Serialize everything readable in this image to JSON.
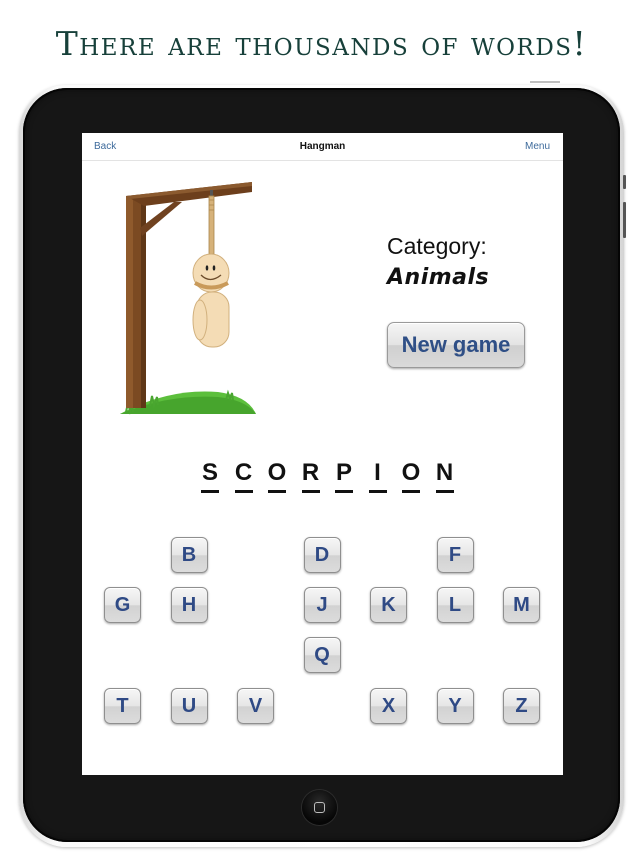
{
  "headline": "There are thousands of words!",
  "nav": {
    "back_label": "Back",
    "title": "Hangman",
    "menu_label": "Menu"
  },
  "category": {
    "label": "Category:",
    "value": "Animals"
  },
  "new_game_label": "New game",
  "word": {
    "letters": [
      "S",
      "C",
      "O",
      "R",
      "P",
      "I",
      "O",
      "N"
    ]
  },
  "keyboard": {
    "rows": [
      [
        "",
        "B",
        "",
        "D",
        "",
        "F",
        ""
      ],
      [
        "G",
        "H",
        "",
        "J",
        "K",
        "L",
        "M"
      ],
      [
        "",
        "",
        "",
        "Q",
        "",
        "",
        ""
      ],
      [
        "T",
        "U",
        "V",
        "",
        "X",
        "Y",
        "Z"
      ]
    ]
  },
  "colors": {
    "headline": "#17403a",
    "nav_link": "#3d6a9b",
    "key_text": "#2f4a85",
    "bezel": "#161616"
  },
  "icons": {
    "home": "home-button-square-icon"
  }
}
